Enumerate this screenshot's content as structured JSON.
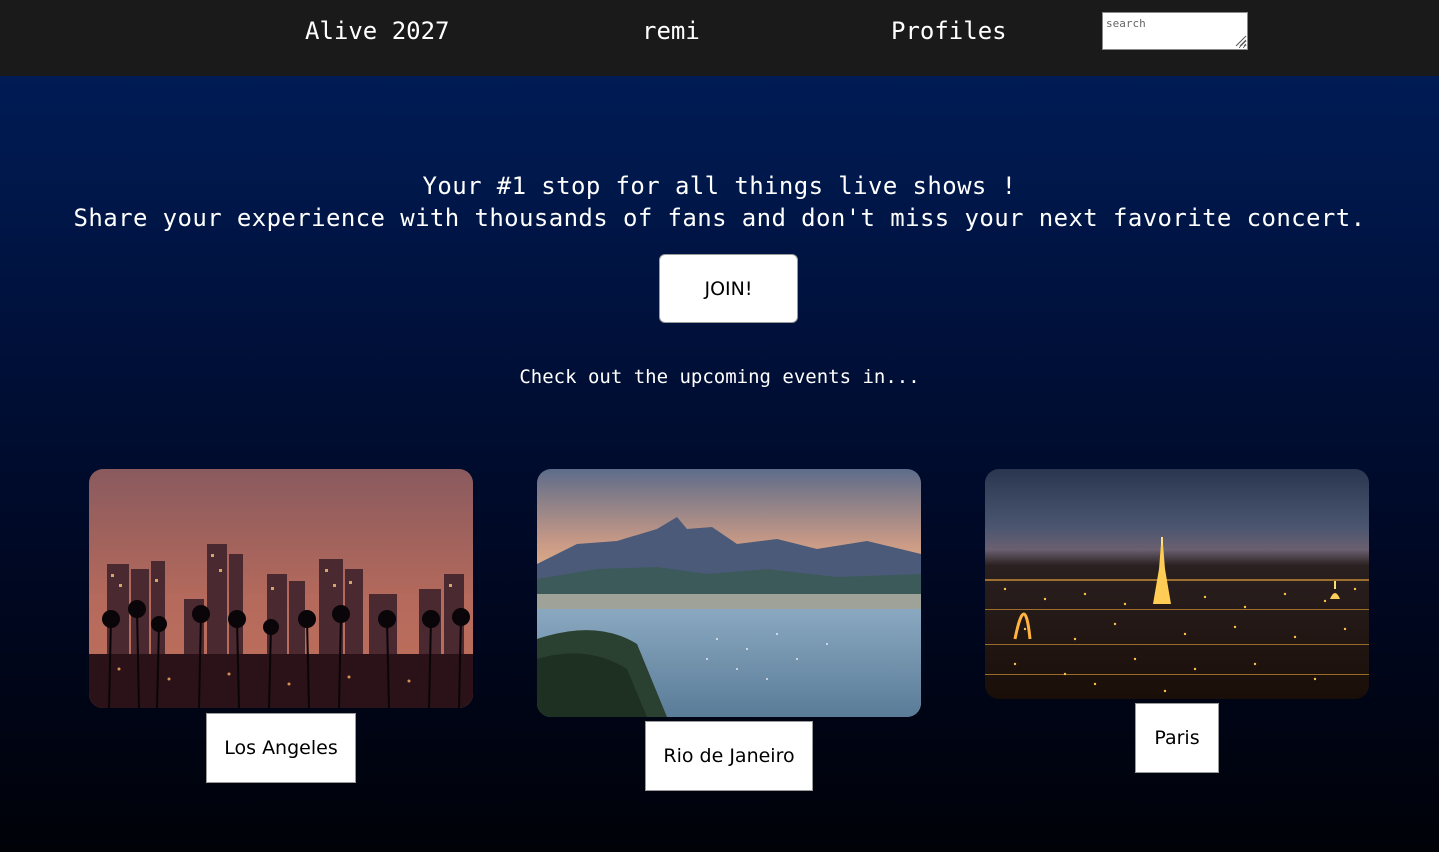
{
  "nav": {
    "brand": "Alive 2027",
    "user": "remi",
    "profiles": "Profiles",
    "search_placeholder": "search"
  },
  "hero": {
    "line1": "Your #1 stop for all things live shows !",
    "line2": "Share your experience with thousands of fans and don't miss your next favorite concert."
  },
  "join_label": "JOIN!",
  "events_heading": "Check out the upcoming events in...",
  "cities": [
    {
      "name": "Los Angeles",
      "icon": "la-skyline-photo"
    },
    {
      "name": "Rio de Janeiro",
      "icon": "rio-bay-photo"
    },
    {
      "name": "Paris",
      "icon": "paris-night-photo"
    }
  ],
  "colors": {
    "topbar": "#1a1a1a",
    "gradient_top": "#001e5e",
    "gradient_bottom": "#000208"
  }
}
